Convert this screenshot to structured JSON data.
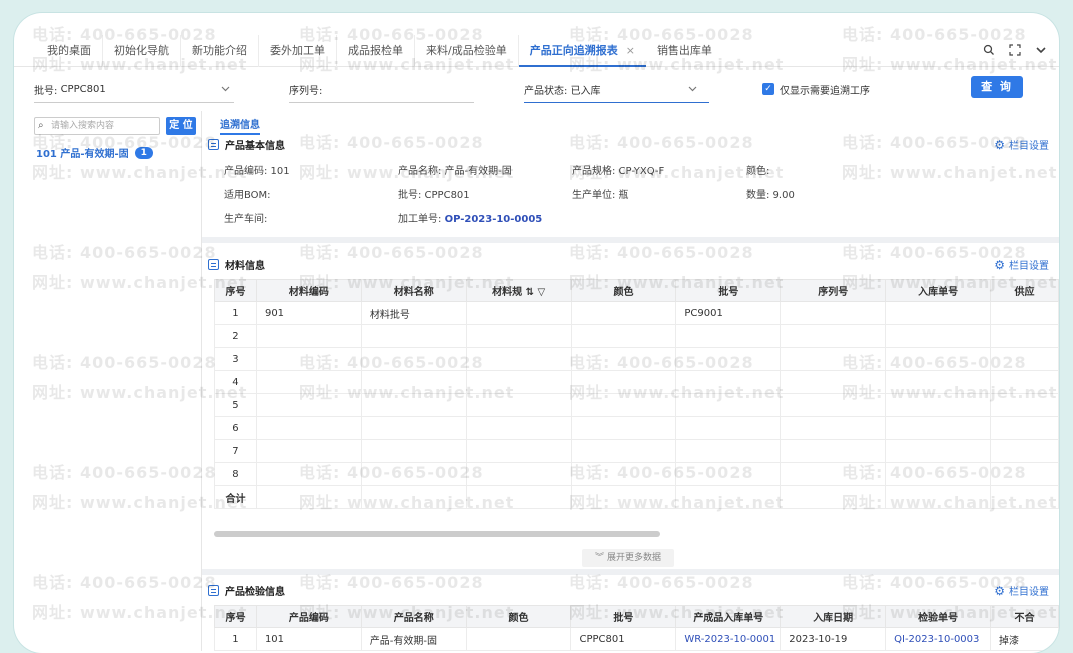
{
  "tabs": [
    "我的桌面",
    "初始化导航",
    "新功能介绍",
    "委外加工单",
    "成品报检单",
    "来料/成品检验单",
    "产品正向追溯报表",
    "销售出库单"
  ],
  "active_tab_close": "×",
  "tab_icons": {
    "search": "search-icon",
    "expand": "fullscreen-icon",
    "more": "chevron-down-icon"
  },
  "filters": {
    "batch_label": "批号:",
    "batch_value": "CPPC801",
    "serial_label": "序列号:",
    "status_label": "产品状态:",
    "status_value": "已入库",
    "only_trace_label": "仅显示需要追溯工序",
    "query": "查 询"
  },
  "left": {
    "search_placeholder": "请输入搜索内容",
    "locate": "定 位",
    "tree_item": "101 产品-有效期-固",
    "tree_badge": "1"
  },
  "trace_tab": "追溯信息",
  "basic": {
    "title": "产品基本信息",
    "col_settings": "栏目设置",
    "product_code": "产品编码: 101",
    "product_name": "产品名称: 产品-有效期-固",
    "spec": "产品规格: CP-YXQ-F",
    "color": "颜色:",
    "bom": "适用BOM:",
    "batch": "批号: CPPC801",
    "unit": "生产单位: 瓶",
    "qty": "数量: 9.00",
    "workshop": "生产车间:",
    "work_order_label": "加工单号:",
    "work_order": "OP-2023-10-0005"
  },
  "material": {
    "title": "材料信息",
    "col_settings": "栏目设置",
    "headers": [
      "序号",
      "材料编码",
      "材料名称",
      "材料规",
      "颜色",
      "批号",
      "序列号",
      "入库单号",
      "供应"
    ],
    "header_icons": "⇅ ▽",
    "rows": [
      [
        "1",
        "901",
        "材料批号",
        "",
        "",
        "PC9001",
        "",
        "",
        ""
      ],
      [
        "2",
        "",
        "",
        "",
        "",
        "",
        "",
        "",
        ""
      ],
      [
        "3",
        "",
        "",
        "",
        "",
        "",
        "",
        "",
        ""
      ],
      [
        "4",
        "",
        "",
        "",
        "",
        "",
        "",
        "",
        ""
      ],
      [
        "5",
        "",
        "",
        "",
        "",
        "",
        "",
        "",
        ""
      ],
      [
        "6",
        "",
        "",
        "",
        "",
        "",
        "",
        "",
        ""
      ],
      [
        "7",
        "",
        "",
        "",
        "",
        "",
        "",
        "",
        ""
      ],
      [
        "8",
        "",
        "",
        "",
        "",
        "",
        "",
        "",
        ""
      ]
    ],
    "total": "合计",
    "expand": "展开更多数据"
  },
  "inspection": {
    "title": "产品检验信息",
    "col_settings": "栏目设置",
    "headers": [
      "序号",
      "产品编码",
      "产品名称",
      "颜色",
      "批号",
      "产成品入库单号",
      "入库日期",
      "检验单号",
      "不合"
    ],
    "rows": [
      [
        "1",
        "101",
        "产品-有效期-固",
        "",
        "CPPC801",
        "WR-2023-10-0001",
        "2023-10-19",
        "QI-2023-10-0003",
        "掉漆"
      ]
    ]
  },
  "watermark": {
    "phone": "电话: 400-665-0028",
    "site": "网址: www.chanjet.net"
  },
  "colors": {
    "accent": "#2f79e6",
    "link": "#2f4fb8"
  }
}
